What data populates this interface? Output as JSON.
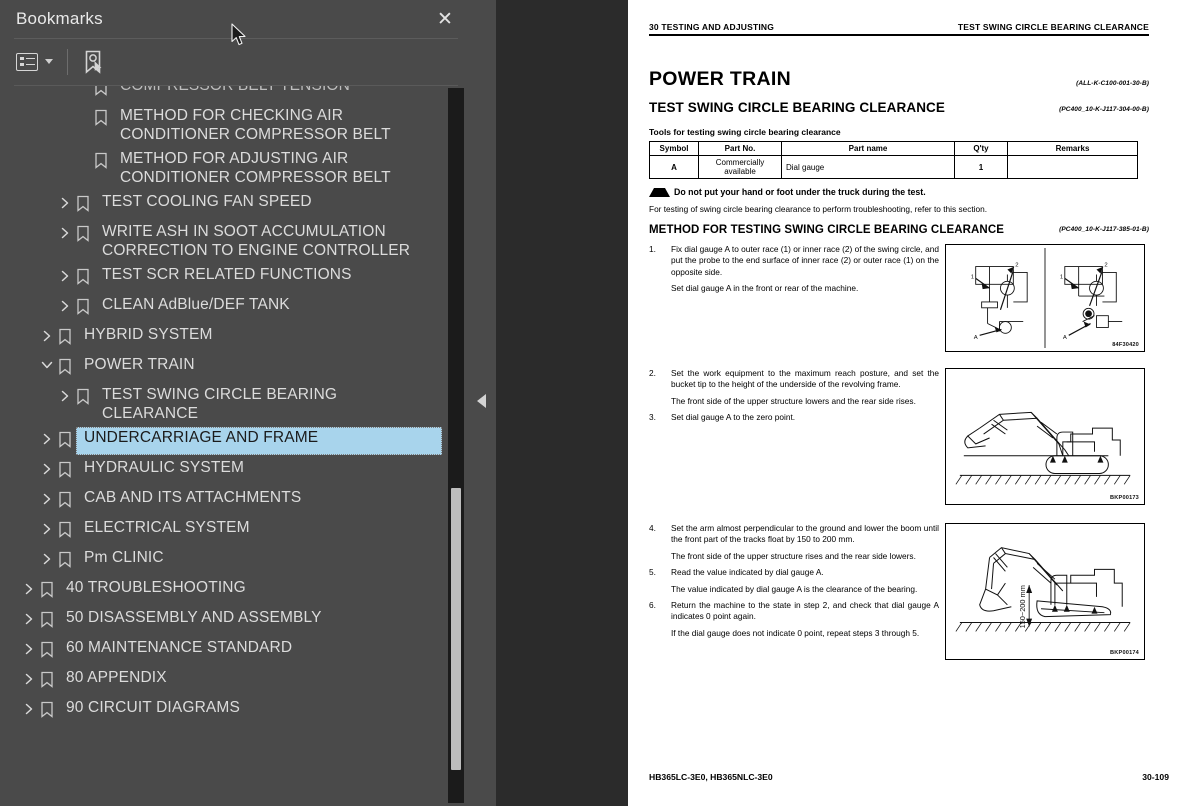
{
  "sidebar": {
    "title": "Bookmarks",
    "close_icon": "close-icon",
    "toolbar": {
      "list_options_icon": "list-options-icon",
      "dropdown_icon": "chevron-down-icon",
      "find_bookmark_icon": "bookmark-pointer-icon"
    },
    "items": [
      {
        "label": "COMPRESSOR BELT TENSION",
        "indent": 3,
        "twisty": "none",
        "clipped": true,
        "selected": false
      },
      {
        "label": "METHOD FOR CHECKING AIR CONDITIONER COMPRESSOR BELT",
        "indent": 3,
        "twisty": "none",
        "selected": false
      },
      {
        "label": "METHOD FOR ADJUSTING AIR CONDITIONER COMPRESSOR BELT",
        "indent": 3,
        "twisty": "none",
        "selected": false
      },
      {
        "label": "TEST COOLING FAN SPEED",
        "indent": 2,
        "twisty": "collapsed",
        "selected": false
      },
      {
        "label": "WRITE ASH IN SOOT ACCUMULATION CORRECTION TO ENGINE CONTROLLER",
        "indent": 2,
        "twisty": "collapsed",
        "selected": false
      },
      {
        "label": "TEST SCR RELATED FUNCTIONS",
        "indent": 2,
        "twisty": "collapsed",
        "selected": false
      },
      {
        "label": "CLEAN AdBlue/DEF TANK",
        "indent": 2,
        "twisty": "collapsed",
        "selected": false
      },
      {
        "label": "HYBRID SYSTEM",
        "indent": 1,
        "twisty": "collapsed",
        "selected": false
      },
      {
        "label": "POWER TRAIN",
        "indent": 1,
        "twisty": "expanded",
        "selected": false
      },
      {
        "label": "TEST SWING CIRCLE BEARING CLEARANCE",
        "indent": 2,
        "twisty": "collapsed",
        "selected": false
      },
      {
        "label": "UNDERCARRIAGE AND FRAME",
        "indent": 1,
        "twisty": "collapsed",
        "selected": true
      },
      {
        "label": "HYDRAULIC SYSTEM",
        "indent": 1,
        "twisty": "collapsed",
        "selected": false
      },
      {
        "label": "CAB AND ITS ATTACHMENTS",
        "indent": 1,
        "twisty": "collapsed",
        "selected": false
      },
      {
        "label": "ELECTRICAL SYSTEM",
        "indent": 1,
        "twisty": "collapsed",
        "selected": false
      },
      {
        "label": "Pm CLINIC",
        "indent": 1,
        "twisty": "collapsed",
        "selected": false
      },
      {
        "label": "40 TROUBLESHOOTING",
        "indent": 0,
        "twisty": "collapsed",
        "selected": false
      },
      {
        "label": "50 DISASSEMBLY AND ASSEMBLY",
        "indent": 0,
        "twisty": "collapsed",
        "selected": false
      },
      {
        "label": "60 MAINTENANCE STANDARD",
        "indent": 0,
        "twisty": "collapsed",
        "selected": false
      },
      {
        "label": "80 APPENDIX",
        "indent": 0,
        "twisty": "collapsed",
        "selected": false
      },
      {
        "label": "90 CIRCUIT DIAGRAMS",
        "indent": 0,
        "twisty": "collapsed",
        "selected": false
      }
    ],
    "selection_color": "#a8d4ec",
    "panel_color": "#4a4a4a",
    "text_color": "#dcdcdc"
  },
  "splitter": {
    "collapse_icon": "collapse-left-arrow-icon"
  },
  "document": {
    "running_head_left": "30 TESTING AND ADJUSTING",
    "running_head_right": "TEST SWING CIRCLE BEARING CLEARANCE",
    "title": "POWER TRAIN",
    "title_code": "(ALL-K-C100-001-30-B)",
    "subtitle": "TEST SWING CIRCLE BEARING CLEARANCE",
    "subtitle_code": "(PC400_10-K-J117-304-00-B)",
    "tools_caption": "Tools for testing swing circle bearing clearance",
    "table": {
      "headers": [
        "Symbol",
        "Part No.",
        "Part name",
        "Q'ty",
        "Remarks"
      ],
      "rows": [
        [
          "A",
          "Commercially available",
          "Dial gauge",
          "1",
          ""
        ]
      ]
    },
    "warning": "Do not put your hand or foot under the truck during the test.",
    "warning_icon": "warning-triangle-icon",
    "note": "For testing of swing circle bearing clearance to perform troubleshooting, refer to this section.",
    "method_head": "METHOD FOR TESTING SWING CIRCLE BEARING CLEARANCE",
    "method_code": "(PC400_10-K-J117-385-01-B)",
    "blocks": [
      {
        "steps": [
          {
            "n": "1.",
            "paras": [
              "Fix dial gauge A to outer race (1) or inner race (2) of the swing circle, and put the probe to the end surface of inner race (2) or outer race (1) on the opposite side.",
              "Set dial gauge A in the front or rear of the machine."
            ]
          }
        ],
        "figure": {
          "code": "84F30420",
          "name": "swing-circle-dial-gauge-figure"
        }
      },
      {
        "steps": [
          {
            "n": "2.",
            "paras": [
              "Set the work equipment to the maximum reach posture, and set the bucket tip to the height of the underside of the revolving frame.",
              "The front side of the upper structure lowers and the rear side rises."
            ]
          },
          {
            "n": "3.",
            "paras": [
              "Set dial gauge A to the zero point."
            ]
          }
        ],
        "figure": {
          "code": "BKP00173",
          "name": "excavator-max-reach-figure"
        }
      },
      {
        "steps": [
          {
            "n": "4.",
            "paras": [
              "Set the arm almost perpendicular to the ground and lower the boom until the front part of the tracks float by 150 to 200 mm.",
              "The front side of the upper structure rises and the rear side lowers."
            ]
          },
          {
            "n": "5.",
            "paras": [
              "Read the value indicated by dial gauge A.",
              "The value indicated by dial gauge A is the clearance of the bearing."
            ]
          },
          {
            "n": "6.",
            "paras": [
              "Return the machine to the state in step 2, and check that dial gauge A indicates 0 point again.",
              "If the dial gauge does not indicate 0 point, repeat steps 3 through 5."
            ]
          }
        ],
        "figure": {
          "code": "BKP00174",
          "name": "excavator-lifted-track-figure",
          "dim_label": "150~200 mm"
        }
      }
    ],
    "footer_left": "HB365LC-3E0, HB365NLC-3E0",
    "footer_right": "30-109"
  }
}
